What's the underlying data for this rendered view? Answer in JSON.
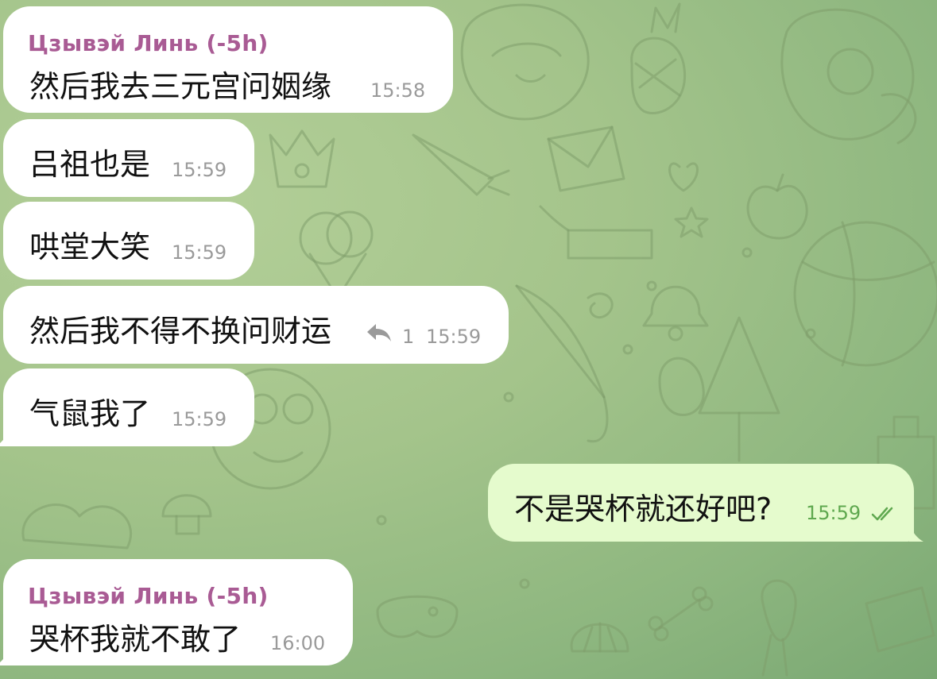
{
  "messages": [
    {
      "sender": "Цзывэй Линь (-5h)",
      "text": "然后我去三元宫问姻缘",
      "time": "15:58",
      "direction": "incoming"
    },
    {
      "text": "吕祖也是",
      "time": "15:59",
      "direction": "incoming"
    },
    {
      "text": "哄堂大笑",
      "time": "15:59",
      "direction": "incoming"
    },
    {
      "text": "然后我不得不换问财运",
      "time": "15:59",
      "direction": "incoming",
      "replies": "1",
      "icon": "reply-arrow-icon"
    },
    {
      "text": "气鼠我了",
      "time": "15:59",
      "direction": "incoming"
    },
    {
      "text": "不是哭杯就还好吧?",
      "time": "15:59",
      "direction": "outgoing",
      "status_icon": "double-check-icon"
    },
    {
      "sender": "Цзывэй Линь (-5h)",
      "text": "哭杯我就不敢了",
      "time": "16:00",
      "direction": "incoming"
    }
  ],
  "colors": {
    "background": "#a4c48b",
    "incoming_bubble": "#ffffff",
    "outgoing_bubble": "#e5fbcd",
    "sender_name": "#a95b94",
    "timestamp": "#9a9a9a",
    "outgoing_timestamp": "#5fa84f"
  }
}
